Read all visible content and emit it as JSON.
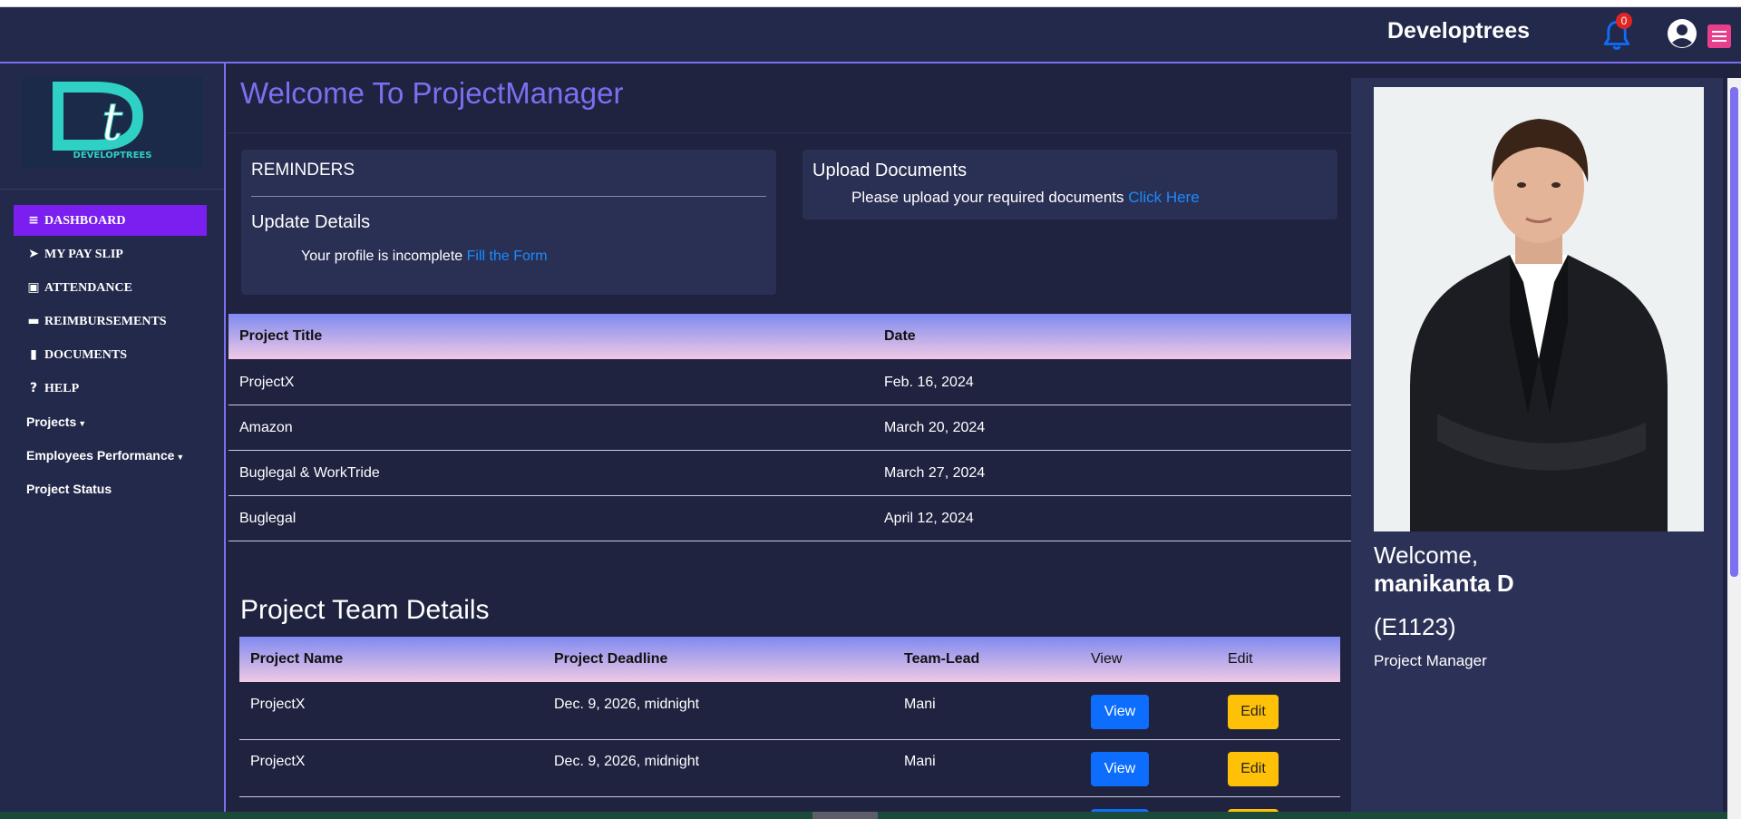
{
  "header": {
    "brand": "Developtrees",
    "notification_count": "0",
    "accent": "#7c6ff0"
  },
  "sidebar": {
    "logo_text": "DEVELOPTREES",
    "items": [
      {
        "label": "DASHBOARD",
        "icon": "bars-icon"
      },
      {
        "label": "MY PAY SLIP",
        "icon": "paper-plane-icon"
      },
      {
        "label": "ATTENDANCE",
        "icon": "calendar-icon"
      },
      {
        "label": "REIMBURSEMENTS",
        "icon": "credit-card-icon"
      },
      {
        "label": "DOCUMENTS",
        "icon": "file-icon"
      },
      {
        "label": "HELP",
        "icon": "question-circle-icon"
      },
      {
        "label": "Projects",
        "icon": "caret-down-icon"
      },
      {
        "label": "Employees Performance",
        "icon": "caret-down-icon"
      },
      {
        "label": "Project Status",
        "icon": ""
      }
    ]
  },
  "main": {
    "title": "Welcome To ProjectManager",
    "reminders": {
      "heading": "REMINDERS",
      "subheading": "Update Details",
      "text": "Your profile is incomplete",
      "link": "Fill the Form"
    },
    "upload": {
      "heading": "Upload Documents",
      "text": "Please upload your required documents",
      "link": "Click Here"
    },
    "projects_table": {
      "headers": [
        "Project Title",
        "Date"
      ],
      "rows": [
        [
          "ProjectX",
          "Feb. 16, 2024"
        ],
        [
          "Amazon",
          "March 20, 2024"
        ],
        [
          "Buglegal & WorkTride",
          "March 27, 2024"
        ],
        [
          "Buglegal",
          "April 12, 2024"
        ]
      ]
    },
    "team": {
      "title": "Project Team Details",
      "headers": [
        "Project Name",
        "Project Deadline",
        "Team-Lead",
        "View",
        "Edit"
      ],
      "rows": [
        {
          "name": "ProjectX",
          "deadline": "Dec. 9, 2026, midnight",
          "lead": "Mani",
          "view": "View",
          "edit": "Edit"
        },
        {
          "name": "ProjectX",
          "deadline": "Dec. 9, 2026, midnight",
          "lead": "Mani",
          "view": "View",
          "edit": "Edit"
        }
      ]
    }
  },
  "profile": {
    "welcome": "Welcome,",
    "name": "manikanta D",
    "id": "(E1123)",
    "role": "Project Manager"
  }
}
